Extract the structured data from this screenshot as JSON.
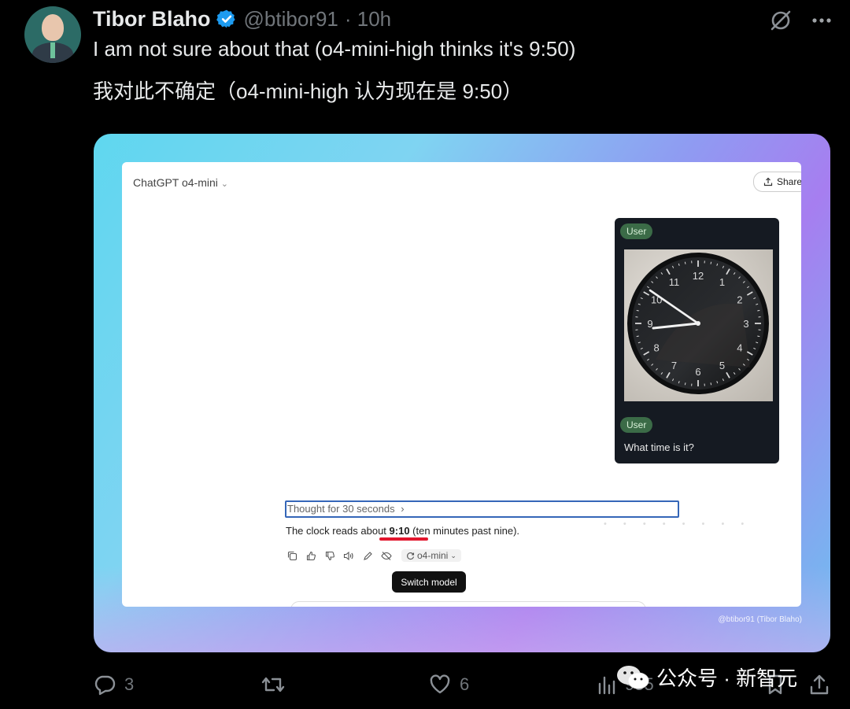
{
  "tweet": {
    "author_name": "Tibor Blaho",
    "handle": "@btibor91",
    "time": "· 10h",
    "text_en": "I am not sure about that (o4-mini-high thinks it's 9:50)",
    "text_zh": "我对此不确定（o4-mini-high 认为现在是 9:50）"
  },
  "screenshot": {
    "model_title": "ChatGPT o4-mini",
    "share_label": "Share",
    "user_badge_1": "User",
    "user_badge_2": "User",
    "user_question": "What time is it?",
    "thought_label": "Thought for 30 seconds",
    "answer_pre": "The clock reads about ",
    "answer_time": "9:10",
    "answer_post": " (ten minutes past nine).",
    "switch_model_chip": "o4-mini",
    "tooltip": "Switch model",
    "credit": "@btibor91 (Tibor Blaho)",
    "clock_numerals": [
      "12",
      "1",
      "2",
      "3",
      "4",
      "5",
      "6",
      "7",
      "8",
      "9",
      "10",
      "11"
    ]
  },
  "stats": {
    "replies": "3",
    "likes": "6",
    "views": "955"
  },
  "watermark": "公众号 · 新智元",
  "colors": {
    "background": "#000000",
    "verified_blue": "#1d9bf0",
    "muted_text": "#71767b",
    "highlight_red": "#e2162d",
    "focus_blue": "#3566b8"
  }
}
